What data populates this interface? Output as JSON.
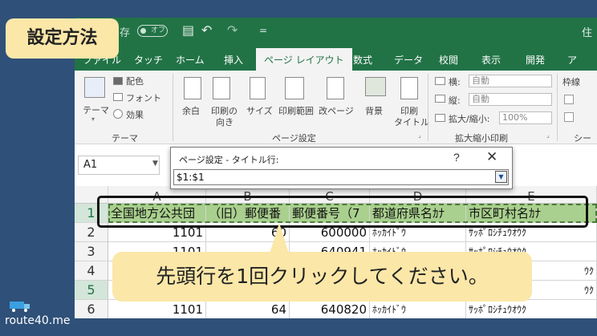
{
  "badge": "設定方法",
  "titlebar": {
    "autosave_label": "存",
    "autosave_toggle": "オフ",
    "save_icon": "▤",
    "undo_icon": "↶",
    "redo_icon": "↷",
    "customize_icon": "=",
    "right_text": "住"
  },
  "tabs": [
    "ファイル",
    "タッチ",
    "ホーム",
    "挿入",
    "ページ レイアウト",
    "数式",
    "データ",
    "校閲",
    "表示",
    "開発",
    "ア"
  ],
  "ribbon": {
    "theme": {
      "btn": "テーマ",
      "colors": "配色",
      "fonts": "フォント",
      "effects": "効果",
      "group": "テーマ"
    },
    "page_setup": {
      "margins": "余白",
      "orientation": [
        "印刷の",
        "向き"
      ],
      "size": "サイズ",
      "print_area": "印刷範囲",
      "breaks": "改ページ",
      "background": "背景",
      "print_titles": [
        "印刷",
        "タイトル"
      ],
      "group": "ページ設定"
    },
    "scale": {
      "width_label": "横:",
      "width_value": "自動",
      "height_label": "縦:",
      "height_value": "自動",
      "scale_label": "拡大/縮小:",
      "scale_value": "100%",
      "group": "拡大縮小印刷"
    },
    "sheet_options": {
      "label": "枠線",
      "group": "シー"
    }
  },
  "namebox": "A1",
  "dialog": {
    "title": "ページ設定 - タイトル行:",
    "help": "?",
    "close": "✕",
    "value": "$1:$1"
  },
  "columns": [
    "A",
    "B",
    "C",
    "D",
    "E"
  ],
  "rows": [
    {
      "n": "1",
      "cells": [
        "全国地方公共団",
        "（旧）郵便番",
        "郵便番号（7",
        "都道府県名ｶﾅ",
        "市区町村名ｶﾅ"
      ]
    },
    {
      "n": "2",
      "cells": [
        "1101",
        "60",
        "600000",
        "ﾎｯｶｲﾄﾞｳ",
        "ｻｯﾎﾟﾛｼﾁｭｳｵｳｸ"
      ]
    },
    {
      "n": "3",
      "cells": [
        "1101",
        "",
        "640941",
        "ﾎｯｶｲﾄﾞｳ",
        "ｻｯﾎﾟﾛｼﾁｭｳｵｳｸ"
      ]
    },
    {
      "n": "4",
      "cells": [
        "",
        "",
        "",
        "",
        "ｳｸ"
      ]
    },
    {
      "n": "5",
      "cells": [
        "",
        "",
        "",
        "",
        "ｳｸ"
      ]
    },
    {
      "n": "6",
      "cells": [
        "1101",
        "64",
        "640820",
        "ﾎｯｶｲﾄﾞｳ",
        "ｻｯﾎﾟﾛｼﾁｭｳｵｳｸ"
      ]
    }
  ],
  "callout": "先頭行を1回クリックしてください。",
  "watermark": "route40.me",
  "colors": {
    "excel_green": "#217346",
    "header_fill": "#a9d08e",
    "callout": "#fbe7a8",
    "background": "#2f5078"
  }
}
